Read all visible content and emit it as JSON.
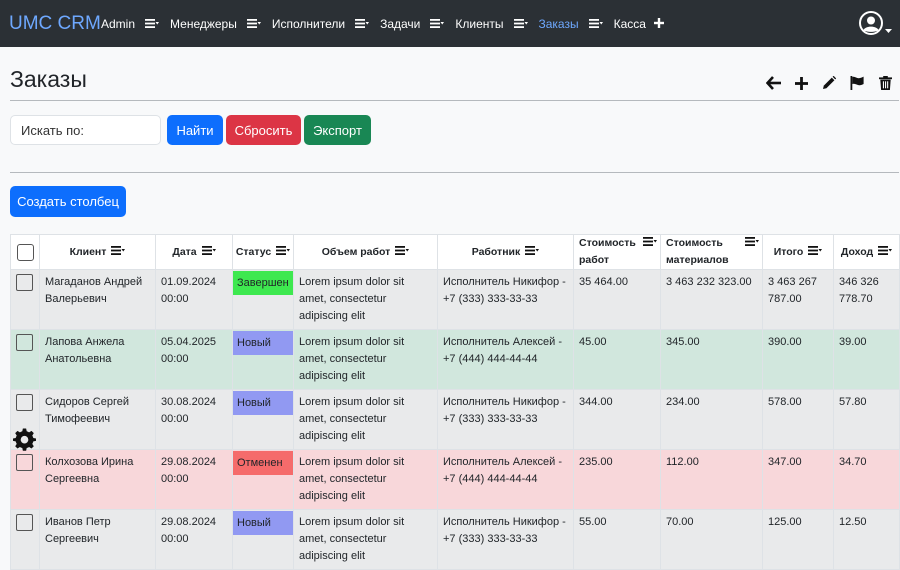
{
  "app": {
    "brand": "UMC CRM"
  },
  "nav": [
    {
      "label": "Admin",
      "icon": "menu-icon",
      "active": false
    },
    {
      "label": "Менеджеры",
      "icon": "menu-icon",
      "active": false
    },
    {
      "label": "Исполнители",
      "icon": "menu-icon",
      "active": false
    },
    {
      "label": "Задачи",
      "icon": "menu-icon",
      "active": false
    },
    {
      "label": "Клиенты",
      "icon": "menu-icon",
      "active": false
    },
    {
      "label": "Заказы",
      "icon": "menu-icon",
      "active": true
    },
    {
      "label": "Касса",
      "icon": "plus-icon",
      "active": false
    }
  ],
  "page": {
    "title": "Заказы"
  },
  "actions": [
    "back-icon",
    "plus-icon",
    "pencil-icon",
    "flag-icon",
    "trash-icon"
  ],
  "search": {
    "placeholder": "Искать по:"
  },
  "buttons": {
    "find": "Найти",
    "reset": "Сбросить",
    "export": "Экспорт",
    "create_column": "Создать столбец"
  },
  "table": {
    "headers": [
      "Клиент",
      "Дата",
      "Статус",
      "Объем работ",
      "Работник",
      "Стоимость работ",
      "Стоимость материалов",
      "Итого",
      "Доход"
    ],
    "rows": [
      {
        "style": "gray",
        "client": "Магаданов Андрей Валерьевич",
        "date": "01.09.2024 00:00",
        "status": "Завершен",
        "status_color": "#3ee84f",
        "work": "Lorem ipsum dolor sit amet, consectetur adipiscing elit",
        "worker": "Исполнитель Никифор - +7 (333) 333-33-33",
        "work_cost": "35 464.00",
        "material_cost": "3 463 232 323.00",
        "total": "3 463 267 787.00",
        "income": "346 326 778.70"
      },
      {
        "style": "green",
        "client": "Лапова Анжела Анатольевна",
        "date": "05.04.2025 00:00",
        "status": "Новый",
        "status_color": "#9199f2",
        "work": "Lorem ipsum dolor sit amet, consectetur adipiscing elit",
        "worker": "Исполнитель Алексей - +7 (444) 444-44-44",
        "work_cost": "45.00",
        "material_cost": "345.00",
        "total": "390.00",
        "income": "39.00"
      },
      {
        "style": "gray",
        "client": "Сидоров Сергей Тимофеевич",
        "date": "30.08.2024 00:00",
        "status": "Новый",
        "status_color": "#9199f2",
        "work": "Lorem ipsum dolor sit amet, consectetur adipiscing elit",
        "worker": "Исполнитель Никифор - +7 (333) 333-33-33",
        "work_cost": "344.00",
        "material_cost": "234.00",
        "total": "578.00",
        "income": "57.80"
      },
      {
        "style": "red",
        "client": "Колхозова Ирина Сергеевна",
        "date": "29.08.2024 00:00",
        "status": "Отменен",
        "status_color": "#f56b6b",
        "work": "Lorem ipsum dolor sit amet, consectetur adipiscing elit",
        "worker": "Исполнитель Алексей - +7 (444) 444-44-44",
        "work_cost": "235.00",
        "material_cost": "112.00",
        "total": "347.00",
        "income": "34.70"
      },
      {
        "style": "gray",
        "client": "Иванов Петр Сергеевич",
        "date": "29.08.2024 00:00",
        "status": "Новый",
        "status_color": "#9199f2",
        "work": "Lorem ipsum dolor sit amet, consectetur adipiscing elit",
        "worker": "Исполнитель Никифор - +7 (333) 333-33-33",
        "work_cost": "55.00",
        "material_cost": "70.00",
        "total": "125.00",
        "income": "12.50"
      }
    ]
  }
}
